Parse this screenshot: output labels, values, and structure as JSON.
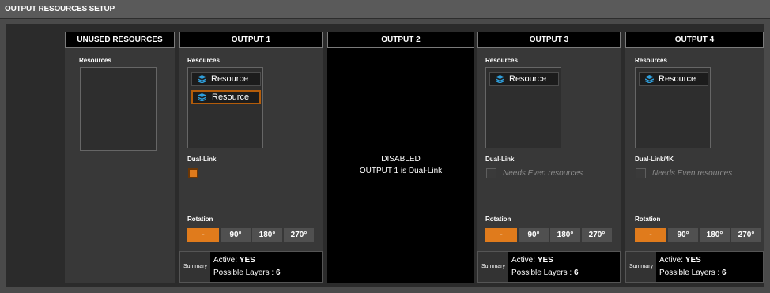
{
  "window": {
    "title": "OUTPUT RESOURCES SETUP"
  },
  "unused": {
    "header": "UNUSED RESOURCES",
    "resources_label": "Resources"
  },
  "outputs": [
    {
      "header": "OUTPUT 1",
      "resources_label": "Resources",
      "resources": [
        "Resource",
        "Resource"
      ],
      "duallink_label": "Dual-Link",
      "rotation_label": "Rotation",
      "rotations": [
        "-",
        "90°",
        "180°",
        "270°"
      ],
      "summary_label": "Summary",
      "active_label": "Active:",
      "active_value": "YES",
      "layers_label": "Possible Layers :",
      "layers_value": "6"
    },
    {
      "header": "OUTPUT 2",
      "disabled_line1": "DISABLED",
      "disabled_line2": "OUTPUT 1 is Dual-Link"
    },
    {
      "header": "OUTPUT 3",
      "resources_label": "Resources",
      "resources": [
        "Resource"
      ],
      "duallink_label": "Dual-Link",
      "duallink_note": "Needs Even resources",
      "rotation_label": "Rotation",
      "rotations": [
        "-",
        "90°",
        "180°",
        "270°"
      ],
      "summary_label": "Summary",
      "active_label": "Active:",
      "active_value": "YES",
      "layers_label": "Possible Layers :",
      "layers_value": "6"
    },
    {
      "header": "OUTPUT 4",
      "resources_label": "Resources",
      "resources": [
        "Resource"
      ],
      "duallink_label": "Dual-Link/4K",
      "duallink_note": "Needs Even resources",
      "rotation_label": "Rotation",
      "rotations": [
        "-",
        "90°",
        "180°",
        "270°"
      ],
      "summary_label": "Summary",
      "active_label": "Active:",
      "active_value": "YES",
      "layers_label": "Possible Layers :",
      "layers_value": "6"
    }
  ],
  "colors": {
    "accent": "#e07b1c",
    "selected_border": "#b35c0a",
    "layer_icon": "#2f9fdc"
  },
  "icons": {
    "resource": "layers-icon"
  }
}
